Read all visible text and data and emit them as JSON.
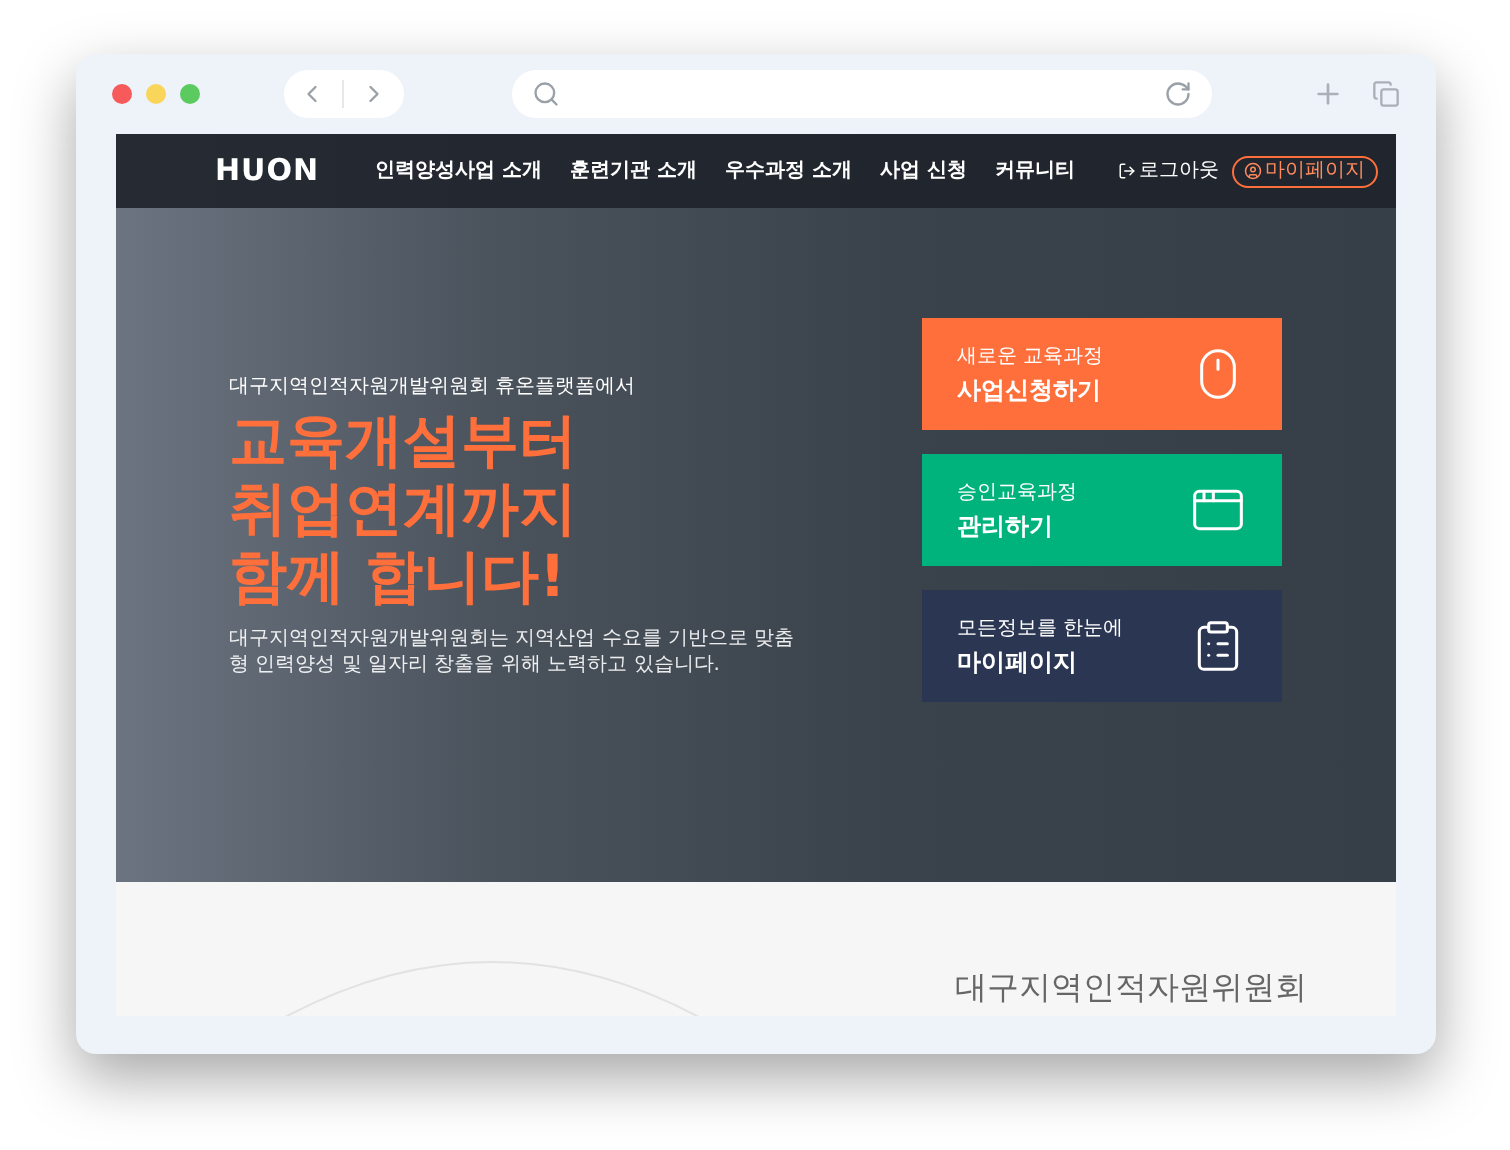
{
  "header": {
    "logo": "HUON",
    "nav": [
      {
        "label": "인력양성사업 소개"
      },
      {
        "label": "훈련기관 소개"
      },
      {
        "label": "우수과정 소개"
      },
      {
        "label": "사업 신청"
      },
      {
        "label": "커뮤니티"
      }
    ],
    "logout": "로그아웃",
    "mypage": "마이페이지"
  },
  "hero": {
    "eyebrow": "대구지역인적자원개발위원회 휴온플랫폼에서",
    "headline": [
      "교육개설부터",
      "취업연계까지",
      "함께 합니다!"
    ],
    "description": "대구지역인적자원개발위원회는 지역산업 수요를 기반으로 맞춤형 인력양성 및 일자리 창출을 위해 노력하고 있습니다."
  },
  "cards": [
    {
      "kind": "mouse",
      "subtitle": "새로운 교육과정",
      "title": "사업신청하기",
      "color": "#ff6f3c"
    },
    {
      "kind": "browser",
      "subtitle": "승인교육과정",
      "title": "관리하기",
      "color": "#00b27c"
    },
    {
      "kind": "clipboard",
      "subtitle": "모든정보를 한눈에",
      "title": "마이페이지",
      "color": "#2b3752"
    }
  ],
  "section": {
    "title": "대구지역인적자원위원회"
  }
}
